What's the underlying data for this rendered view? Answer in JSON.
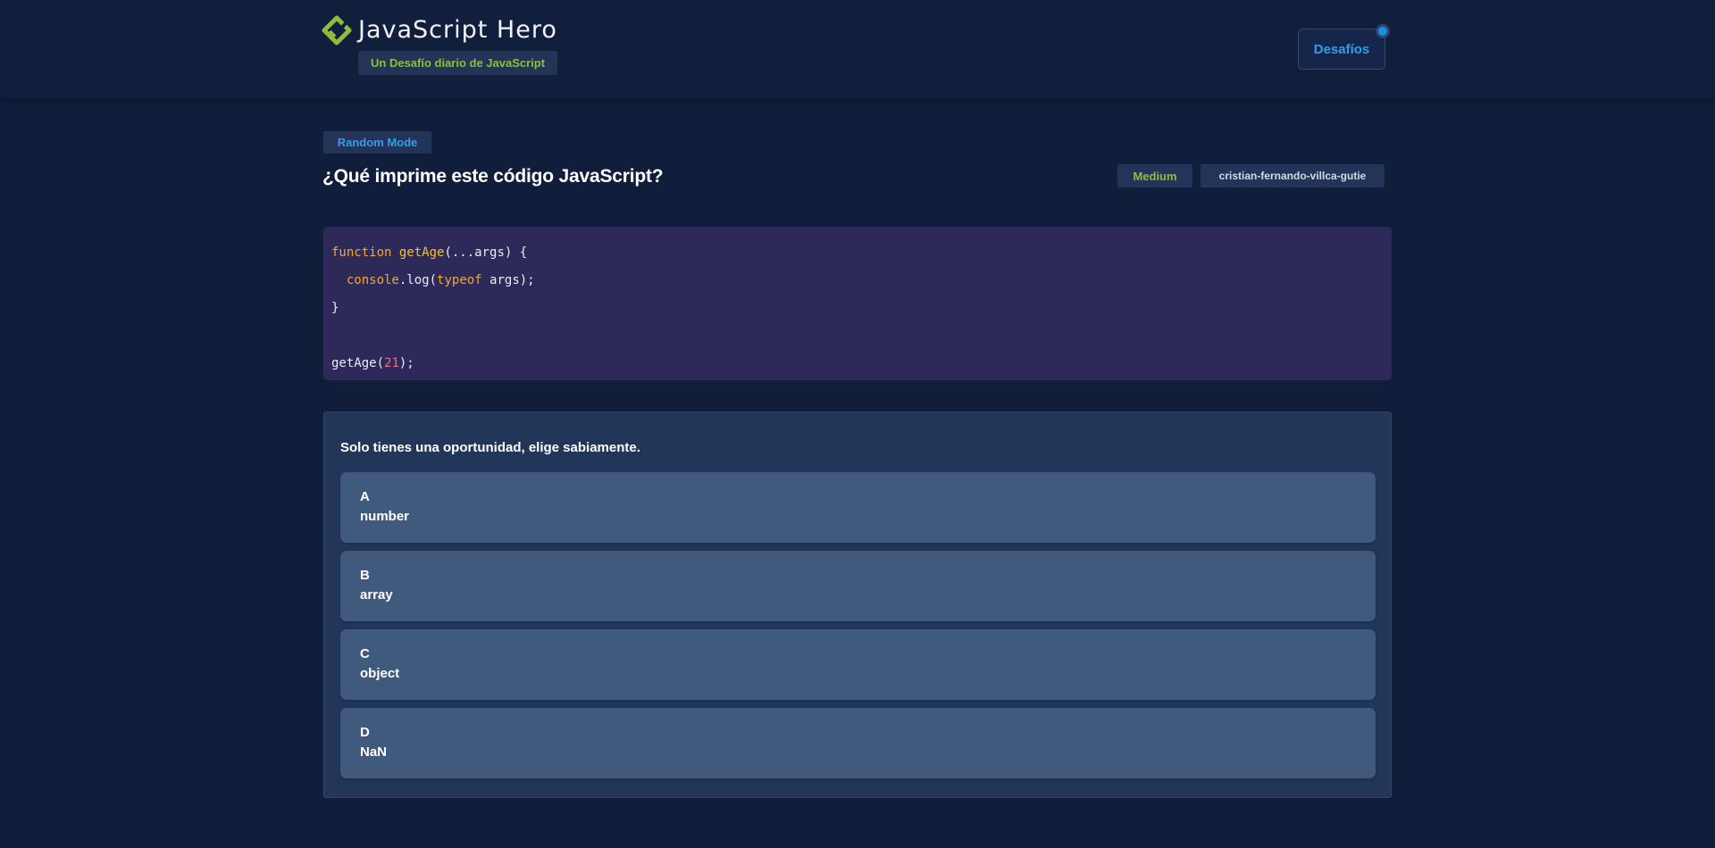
{
  "header": {
    "title": "JavaScript Hero",
    "subtitle": "Un Desafío diario de JavaScript",
    "challenges_label": "Desafíos"
  },
  "challenge": {
    "mode": "Random Mode",
    "title": "¿Qué imprime este código JavaScript?",
    "difficulty": "Medium",
    "author": "cristian-fernando-villca-gutie"
  },
  "code": {
    "lines": [
      "function getAge(...args) {",
      "  console.log(typeof args);",
      "}",
      "",
      "getAge(21);"
    ]
  },
  "quiz": {
    "prompt": "Solo tienes una oportunidad, elige sabiamente.",
    "options": [
      {
        "letter": "A",
        "text": "number"
      },
      {
        "letter": "B",
        "text": "array"
      },
      {
        "letter": "C",
        "text": "object"
      },
      {
        "letter": "D",
        "text": "NaN"
      }
    ]
  },
  "colors": {
    "background": "#101e3b",
    "brand_green": "#8fbc3a",
    "accent_blue": "#2e9fe8",
    "code_bg": "#2d2a5a",
    "option_bg": "#405a7e"
  },
  "icons": {
    "logo": "diamond-check-logo-icon",
    "notification": "notification-dot-icon"
  }
}
